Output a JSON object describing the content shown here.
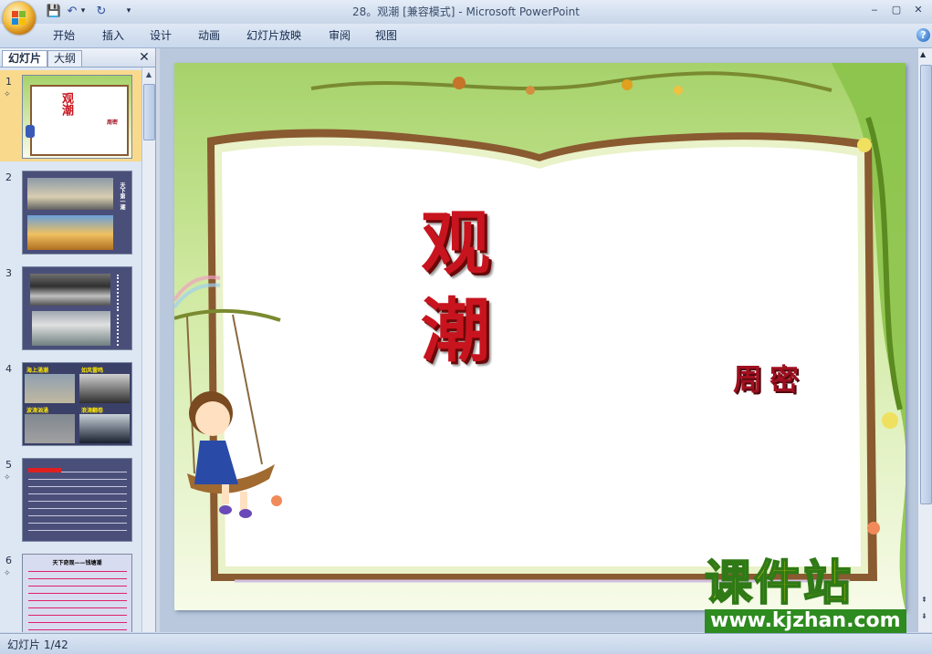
{
  "window": {
    "title": "28。观潮 [兼容模式] - Microsoft PowerPoint",
    "minimize": "‒",
    "maximize": "▢",
    "close": "✕"
  },
  "qat": {
    "save": "💾",
    "undo": "↶",
    "undo_drop": "▾",
    "redo": "↻",
    "customize": "▾"
  },
  "ribbon": {
    "tabs": [
      "开始",
      "插入",
      "设计",
      "动画",
      "幻灯片放映",
      "审阅",
      "视图"
    ],
    "help": "?"
  },
  "left_pane": {
    "tabs": [
      "幻灯片",
      "大纲"
    ],
    "close": "✕",
    "slides": [
      {
        "num": "1",
        "title": "观潮",
        "subtitle": "周密",
        "selected": true,
        "animated": true
      },
      {
        "num": "2",
        "side_text": "天下第一潮",
        "animated": false
      },
      {
        "num": "3",
        "side_text": "",
        "animated": false
      },
      {
        "num": "4",
        "labels": [
          "海上涌潮",
          "如风雷鸣",
          "波涛汹涌",
          "浪涛翻卷"
        ],
        "animated": false
      },
      {
        "num": "5",
        "animated": true
      },
      {
        "num": "6",
        "title": "天下奇观——钱塘潮",
        "animated": true
      }
    ]
  },
  "slide": {
    "title": "观潮",
    "title_chars": [
      "观",
      "潮"
    ],
    "author": "周密"
  },
  "watermark": {
    "main": "课件站",
    "url": "www.kjzhan.com"
  },
  "status": {
    "slide_count": "幻灯片 1/42"
  },
  "colors": {
    "title_red": "#c8141e",
    "author_red": "#a01020",
    "accent_orange": "#f5b44a"
  }
}
